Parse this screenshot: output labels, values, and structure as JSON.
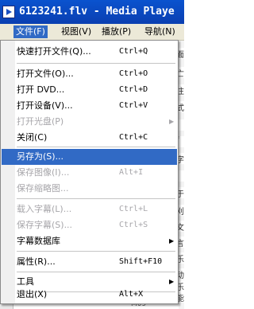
{
  "window": {
    "title": "6123241.flv - Media Playe"
  },
  "menubar": {
    "items": [
      {
        "label": "文件(F)"
      },
      {
        "label": "视图(V)"
      },
      {
        "label": "播放(P)"
      },
      {
        "label": "导航(N)"
      }
    ]
  },
  "file_menu": {
    "items": [
      {
        "label": "快速打开文件(Q)...",
        "shortcut": "Ctrl+Q",
        "enabled": true
      },
      {
        "label": "打开文件(O)...",
        "shortcut": "Ctrl+O",
        "enabled": true
      },
      {
        "label": "打开 DVD...",
        "shortcut": "Ctrl+D",
        "enabled": true
      },
      {
        "label": "打开设备(V)...",
        "shortcut": "Ctrl+V",
        "enabled": true
      },
      {
        "label": "打开光盘(P)",
        "shortcut": "",
        "enabled": false,
        "submenu": true
      },
      {
        "label": "关闭(C)",
        "shortcut": "Ctrl+C",
        "enabled": true
      },
      {
        "label": "另存为(S)...",
        "shortcut": "",
        "enabled": true,
        "highlighted": true
      },
      {
        "label": "保存图像(I)...",
        "shortcut": "Alt+I",
        "enabled": false
      },
      {
        "label": "保存缩略图...",
        "shortcut": "",
        "enabled": false
      },
      {
        "label": "载入字幕(L)...",
        "shortcut": "Ctrl+L",
        "enabled": false
      },
      {
        "label": "保存字幕(S)...",
        "shortcut": "Ctrl+S",
        "enabled": false
      },
      {
        "label": "字幕数据库",
        "shortcut": "",
        "enabled": true,
        "submenu": true
      },
      {
        "label": "属性(R)...",
        "shortcut": "Shift+F10",
        "enabled": true
      },
      {
        "label": "工具",
        "shortcut": "",
        "enabled": true,
        "submenu": true
      },
      {
        "label": "退出(X)",
        "shortcut": "Alt+X",
        "enabled": true
      }
    ],
    "submenu_arrow": "▶"
  },
  "background": {
    "fragments": [
      "亡",
      "注",
      "式",
      "i",
      "f",
      "字",
      "i",
      "于",
      "刈",
      "文",
      "言",
      "乐",
      "动",
      "乐",
      "面",
      "能"
    ],
    "bottom_text": "M09"
  }
}
